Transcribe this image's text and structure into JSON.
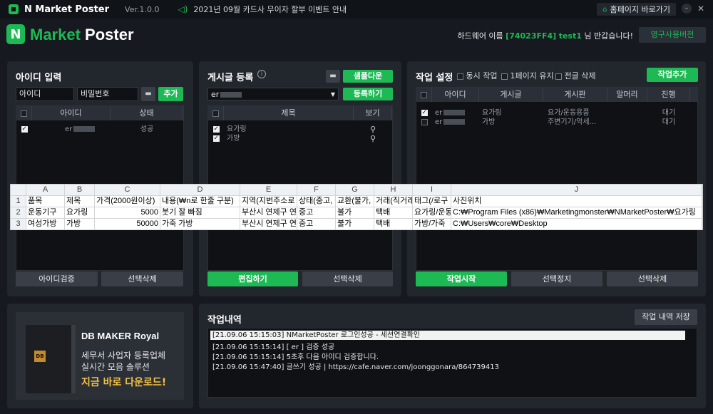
{
  "titlebar": {
    "app_name": "N Market Poster",
    "version": "Ver.1.0.0",
    "notice": "2021년 09월 카드사 무이자 할부 이벤트 안내",
    "homepage_label": "홈페이지 바로가기"
  },
  "header": {
    "logo_n": "N",
    "logo_market": "Market",
    "logo_poster": " Poster",
    "hw_prefix": "하드웨어 이름 ",
    "hw_id": "[74023FF4]",
    "user_id": "test1",
    "greeting_suffix": " 님 반갑습니다!",
    "license_button": "영구사용버전"
  },
  "id_panel": {
    "title": "아이디 입력",
    "id_input": "아이디",
    "pw_input": "비밀번호",
    "add_button": "추가",
    "col_id": "아이디",
    "col_status": "상태",
    "rows": [
      {
        "id": "er",
        "status": "성공",
        "checked": true
      }
    ],
    "verify_button": "아이디검증",
    "delete_button": "선택삭제"
  },
  "post_panel": {
    "title": "게시글 등록",
    "sample_button": "샘플다운",
    "register_button": "등록하기",
    "select_value": "er",
    "col_title": "제목",
    "col_view": "보기",
    "rows": [
      {
        "title": "요가링"
      },
      {
        "title": "가방"
      }
    ],
    "edit_button": "편집하기",
    "delete_button": "선택삭제"
  },
  "job_panel": {
    "title": "작업 설정",
    "opt_simultaneous": "동시 작업",
    "opt_keep_first": "1페이지 유지",
    "opt_delete_all": "전글 삭제",
    "add_button": "작업추가",
    "cols": [
      "아이디",
      "게시글",
      "게시판",
      "말머리",
      "진행"
    ],
    "rows": [
      {
        "id": "er",
        "post": "요가링",
        "board": "요가/운동용품",
        "state": "대기"
      },
      {
        "id": "er",
        "post": "가방",
        "board": "주변기기/악세...",
        "state": "대기"
      }
    ],
    "start_button": "작업시작",
    "stop_button": "선택정지",
    "delete_button": "선택삭제"
  },
  "excel": {
    "col_letters": [
      "A",
      "B",
      "C",
      "D",
      "E",
      "F",
      "G",
      "H",
      "I",
      "J"
    ],
    "rows": [
      {
        "rn": "1",
        "cells": [
          "품목",
          "제목",
          "가격(2000원이상)",
          "내용(₩n로 한줄 구분)",
          "지역(지번주소로",
          "상태(중고,",
          "교환(불가,",
          "거래(직거래",
          "태그(/로구",
          "사진위치"
        ]
      },
      {
        "rn": "2",
        "cells": [
          "운동기구",
          "요가링",
          "5000",
          "붓기 잘 빠짐",
          "부산시 연제구 연",
          "중고",
          "불가",
          "택배",
          "요가링/운동",
          "C:₩Program Files (x86)₩Marketingmonster₩NMarketPoster₩요가링"
        ]
      },
      {
        "rn": "3",
        "cells": [
          "여성가방",
          "가방",
          "50000",
          "가죽 가방",
          "부산시 연제구 연",
          "중고",
          "불가",
          "택배",
          "가방/가죽",
          "C:₩Users₩core₩Desktop"
        ]
      }
    ]
  },
  "ad": {
    "product": "DB MAKER Royal",
    "line1": "세무서 사업자 등록업체",
    "line2": "실시간 모음 솔루션",
    "cta": "지금 바로 다운로드!",
    "badge": "DB"
  },
  "log_panel": {
    "title": "작업내역",
    "save_button": "작업 내역 저장",
    "lines": [
      "[21.09.06 15:15:03]   NMarketPoster 로그인성공 - 세션연결확인",
      "[21.09.06 15:15:14]   [ er              ] 검증 성공",
      "[21.09.06 15:15:14]   5초후 다음 아이디 검증합니다.",
      "[21.09.06 15:47:40]   글쓰기 성공 | https://cafe.naver.com/joonggonara/864739413"
    ]
  },
  "colors": {
    "accent": "#1db954",
    "bg": "#16191f",
    "panel": "#22262d"
  }
}
